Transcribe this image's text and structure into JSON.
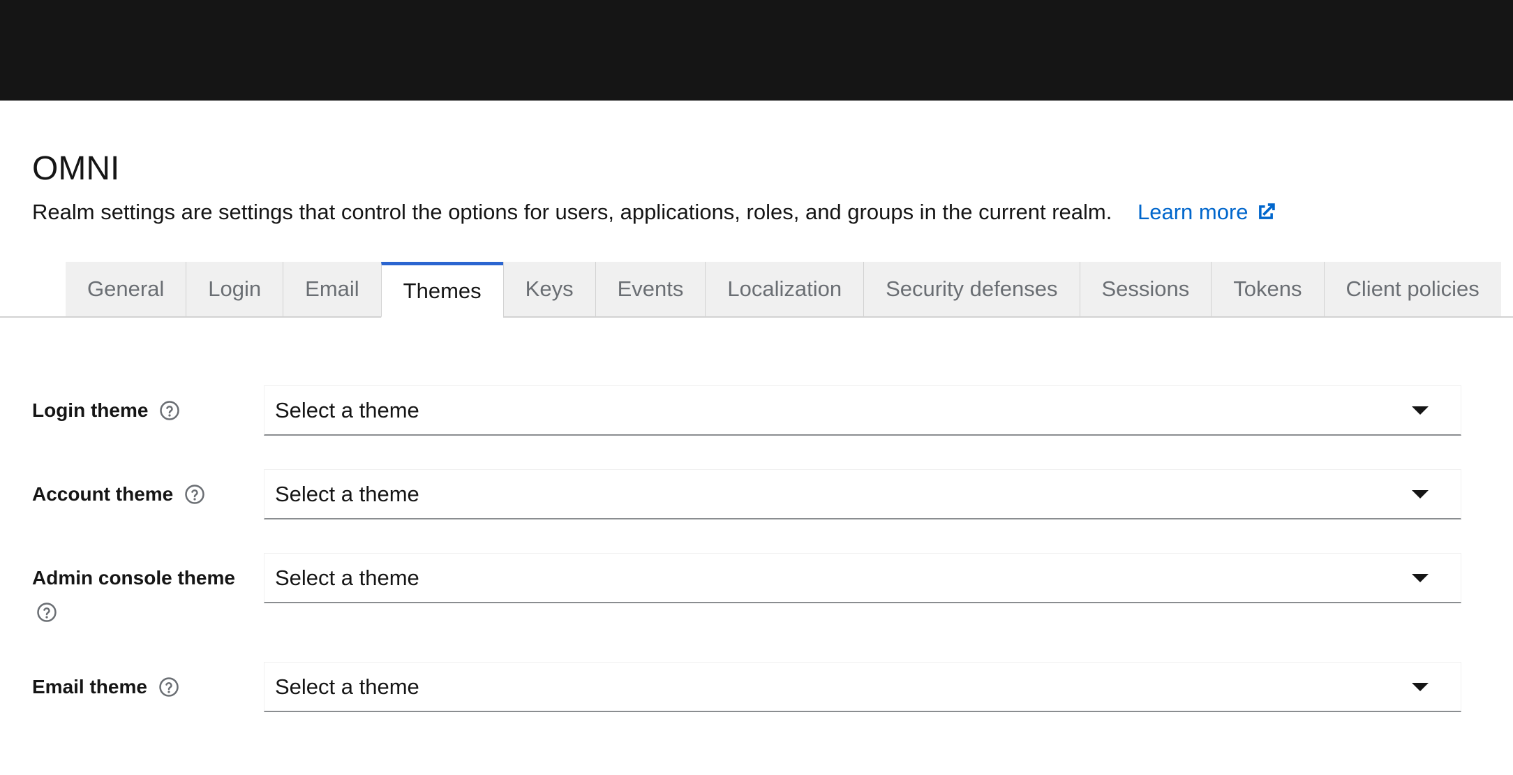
{
  "header": {
    "realm_name": "OMNI",
    "description": "Realm settings are settings that control the options for users, applications, roles, and groups in the current realm.",
    "learn_more_label": "Learn more"
  },
  "tabs": [
    {
      "label": "General",
      "active": false
    },
    {
      "label": "Login",
      "active": false
    },
    {
      "label": "Email",
      "active": false
    },
    {
      "label": "Themes",
      "active": true
    },
    {
      "label": "Keys",
      "active": false
    },
    {
      "label": "Events",
      "active": false
    },
    {
      "label": "Localization",
      "active": false
    },
    {
      "label": "Security defenses",
      "active": false
    },
    {
      "label": "Sessions",
      "active": false
    },
    {
      "label": "Tokens",
      "active": false
    },
    {
      "label": "Client policies",
      "active": false
    }
  ],
  "form": {
    "login_theme": {
      "label": "Login theme",
      "value": "Select a theme"
    },
    "account_theme": {
      "label": "Account theme",
      "value": "Select a theme"
    },
    "admin_console_theme": {
      "label": "Admin console theme",
      "value": "Select a theme"
    },
    "email_theme": {
      "label": "Email theme",
      "value": "Select a theme"
    }
  },
  "colors": {
    "topbar": "#151515",
    "link": "#0066cc",
    "active_tab_accent": "#2b65d0"
  },
  "icons": {
    "external_link": "external-link-icon",
    "help": "help-icon",
    "caret": "caret-down-icon"
  }
}
